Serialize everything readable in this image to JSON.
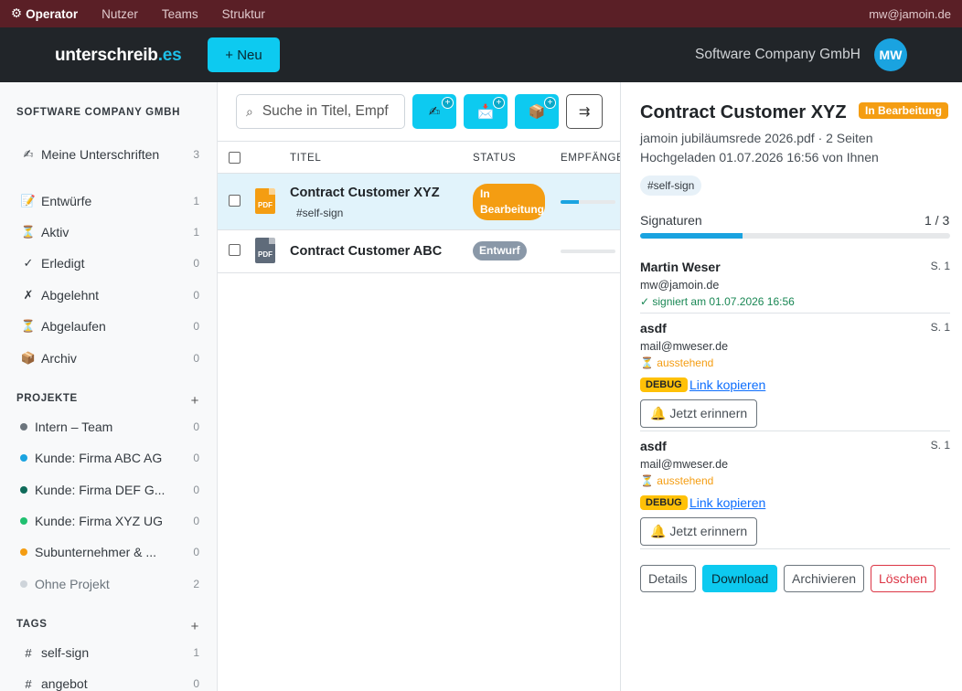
{
  "opbar": {
    "brand": "Operator",
    "brand_icon": "gear-icon",
    "nav": [
      "Nutzer",
      "Teams",
      "Struktur"
    ],
    "email": "mw@jamoin.de"
  },
  "header": {
    "logo_main": "unterschreib",
    "logo_tld": ".es",
    "new_button": "+ Neu",
    "company": "Software Company GmbH",
    "avatar_initials": "MW"
  },
  "sidebar": {
    "company": "SOFTWARE COMPANY GMBH",
    "mine": {
      "icon": "✍",
      "label": "Meine Unterschriften",
      "count": "3"
    },
    "states": [
      {
        "icon": "📝",
        "label": "Entwürfe",
        "count": "1"
      },
      {
        "icon": "⏳",
        "label": "Aktiv",
        "count": "1"
      },
      {
        "icon": "✓",
        "label": "Erledigt",
        "count": "0"
      },
      {
        "icon": "✗",
        "label": "Abgelehnt",
        "count": "0"
      },
      {
        "icon": "⏳",
        "label": "Abgelaufen",
        "count": "0"
      },
      {
        "icon": "📦",
        "label": "Archiv",
        "count": "0"
      }
    ],
    "projects_title": "PROJEKTE",
    "projects": [
      {
        "label": "Intern – Team",
        "count": "0",
        "color": "#6c757d"
      },
      {
        "label": "Kunde: Firma ABC AG",
        "count": "0",
        "color": "#1aa3e0"
      },
      {
        "label": "Kunde: Firma DEF G...",
        "count": "0",
        "color": "#0f6b5a"
      },
      {
        "label": "Kunde: Firma XYZ UG",
        "count": "0",
        "color": "#20c070"
      },
      {
        "label": "Subunternehmer & ...",
        "count": "0",
        "color": "#f49d12"
      },
      {
        "label": "Ohne Projekt",
        "count": "2",
        "color": "#ced4da"
      }
    ],
    "tags_title": "TAGS",
    "tags": [
      {
        "label": "self-sign",
        "count": "1"
      },
      {
        "label": "angebot",
        "count": "0"
      }
    ],
    "add_symbol": "+"
  },
  "list": {
    "search_placeholder": "Suche in Titel, Empf",
    "toolbar_buttons": [
      "✍",
      "📩",
      "📦"
    ],
    "badge_symbol": "+",
    "sort_symbol": "⇉",
    "columns": {
      "title": "TITEL",
      "status": "STATUS",
      "recipients": "EMPFÄNGE"
    },
    "rows": [
      {
        "title": "Contract Customer XYZ",
        "tag": "#self-sign",
        "status": "In Bearbeitung",
        "status_color": "#f49d12",
        "progress": 0.33,
        "pdf_color": "#f49d12",
        "pdf_label": "PDF"
      },
      {
        "title": "Contract Customer ABC",
        "tag": "",
        "status": "Entwurf",
        "status_color": "#8a98a8",
        "progress": 0,
        "pdf_color": "#5f6b7a",
        "pdf_label": "PDF"
      }
    ]
  },
  "detail": {
    "title": "Contract Customer XYZ",
    "status_badge": "In Bearbeitung",
    "file_info": "jamoin jubiläumsrede 2026.pdf · 2 Seiten",
    "uploaded": "Hochgeladen 01.07.2026 16:56 von Ihnen",
    "tag": "#self-sign",
    "signatures_label": "Signaturen",
    "signatures_count": "1 / 3",
    "signatures_progress": 0.33,
    "signers": [
      {
        "name": "Martin Weser",
        "page": "S. 1",
        "email": "mw@jamoin.de",
        "status": "✓ signiert am 01.07.2026 16:56",
        "status_color": "#198754"
      },
      {
        "name": "asdf",
        "page": "S. 1",
        "email": "mail@mweser.de",
        "status": "⏳ ausstehend",
        "status_color": "#f49d12",
        "debug": "DEBUG",
        "link": "Link kopieren",
        "remind": "🔔 Jetzt erinnern"
      },
      {
        "name": "asdf",
        "page": "S. 1",
        "email": "mail@mweser.de",
        "status": "⏳ ausstehend",
        "status_color": "#f49d12",
        "debug": "DEBUG",
        "link": "Link kopieren",
        "remind": "🔔 Jetzt erinnern"
      }
    ],
    "actions": {
      "details": "Details",
      "download": "Download",
      "archive": "Archivieren",
      "delete": "Löschen"
    }
  },
  "colors": {
    "accent": "#0dcaf0",
    "operator_bar": "#5a1f26",
    "header": "#212529",
    "danger": "#dc3545"
  }
}
